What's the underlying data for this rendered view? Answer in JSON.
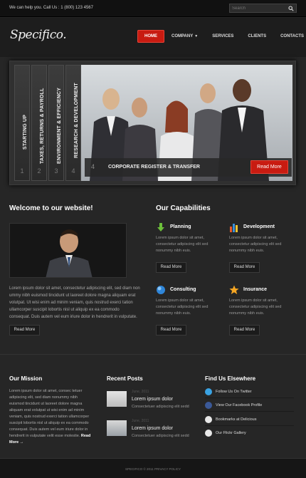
{
  "topbar": {
    "help_text": "We can help you. Call Us : 1 (800) 123 4567",
    "search_placeholder": "Search"
  },
  "brand": {
    "logo": "Specifico."
  },
  "nav": {
    "items": [
      {
        "label": "HOME",
        "active": true
      },
      {
        "label": "COMPANY",
        "has_dropdown": true
      },
      {
        "label": "SERVICES"
      },
      {
        "label": "CLIENTS"
      },
      {
        "label": "CONTACTS"
      }
    ]
  },
  "slider": {
    "tabs": [
      {
        "label": "STARTING UP",
        "num": "1"
      },
      {
        "label": "TAXES, RETURNS & PAYROLL",
        "num": "2"
      },
      {
        "label": "ENVIRONMENT & EFFICIENCY",
        "num": "3"
      },
      {
        "label": "RESEARCH & DEVELOPMENT",
        "num": "4"
      }
    ],
    "caption_num": "4",
    "caption_title": "CORPORATE REGISTER & TRANSFER",
    "read_more": "Read More"
  },
  "welcome": {
    "title": "Welcome to our website!",
    "text": "Lorem ipsum dolor sit amet, consectetur adipiscing elit, sed diam non ummy nibh euismod tincidunt ut laoreet dolore magna aliquam erat volutpat. Ut wisi enim ad minim veniam, quis nostrud exerci tation ullamcorper suscipit lobortis nisl ut aliquip ex ea commodo consequat. Duis autem vel eum iriure dolor in hendrerit in vulputate.",
    "read_more": "Read More"
  },
  "capabilities": {
    "title": "Our Capabilities",
    "items": [
      {
        "name": "Planning",
        "icon": "arrow-down-icon",
        "text": "Lorem ipsum dolor sit amet, consectetur adipiscing elit sed nonummy nibh euis.",
        "button": "Read More"
      },
      {
        "name": "Development",
        "icon": "bar-chart-icon",
        "text": "Lorem ipsum dolor sit amet, consectetur adipiscing elit sed nonummy nibh euis.",
        "button": "Read More"
      },
      {
        "name": "Consulting",
        "icon": "globe-icon",
        "text": "Lorem ipsum dolor sit amet, consectetur adipiscing elit sed nonummy nibh euis.",
        "button": "Read More"
      },
      {
        "name": "Insurance",
        "icon": "star-icon",
        "text": "Lorem ipsum dolor sit amet, consectetur adipiscing elit sed nonummy nibh euis.",
        "button": "Read More"
      }
    ]
  },
  "mission": {
    "title": "Our Mission",
    "text": "Lorem ipsum dolor sit amet, consec tetuer adipiscing elit, sed diam nonummy nibh euismod tincidunt ut laoreet dolore magna aliquam erat volutpat ut wisi enim ad minim veniam, quis nostrud exerci tation ullamcorper suscipit lobortis nisl ut aliquip ex ea commodo consequat. Duis autem vel eum iriure dolor in hendrerit in vulputate velit esse molestie.",
    "read_more": "Read More"
  },
  "recent_posts": {
    "title": "Recent Posts",
    "items": [
      {
        "date": "June, 2011",
        "title": "Lorem ipsum dolor",
        "desc": "Consectetuer adipiscing elit sedd"
      },
      {
        "date": "June, 2011",
        "title": "Lorem ipsum dolor",
        "desc": "Consectetuer adipiscing elit sedd"
      }
    ]
  },
  "find_us": {
    "title": "Find Us Elsewhere",
    "items": [
      {
        "label": "Follow Us On Twitter",
        "icon": "twitter-icon",
        "color": "#3aa3e3"
      },
      {
        "label": "View Our Facebook Profile",
        "icon": "facebook-icon",
        "color": "#3b5998"
      },
      {
        "label": "Bookmarks at Delicious",
        "icon": "delicious-icon",
        "color": "#e8e8e8"
      },
      {
        "label": "Our Flickr Gallery",
        "icon": "flickr-icon",
        "color": "#e8e8e8"
      }
    ]
  },
  "footer": {
    "copyright": "SPECIFICO © 2011 PRIVACY POLICY"
  },
  "colors": {
    "accent": "#c81b11",
    "background": "#262626"
  }
}
